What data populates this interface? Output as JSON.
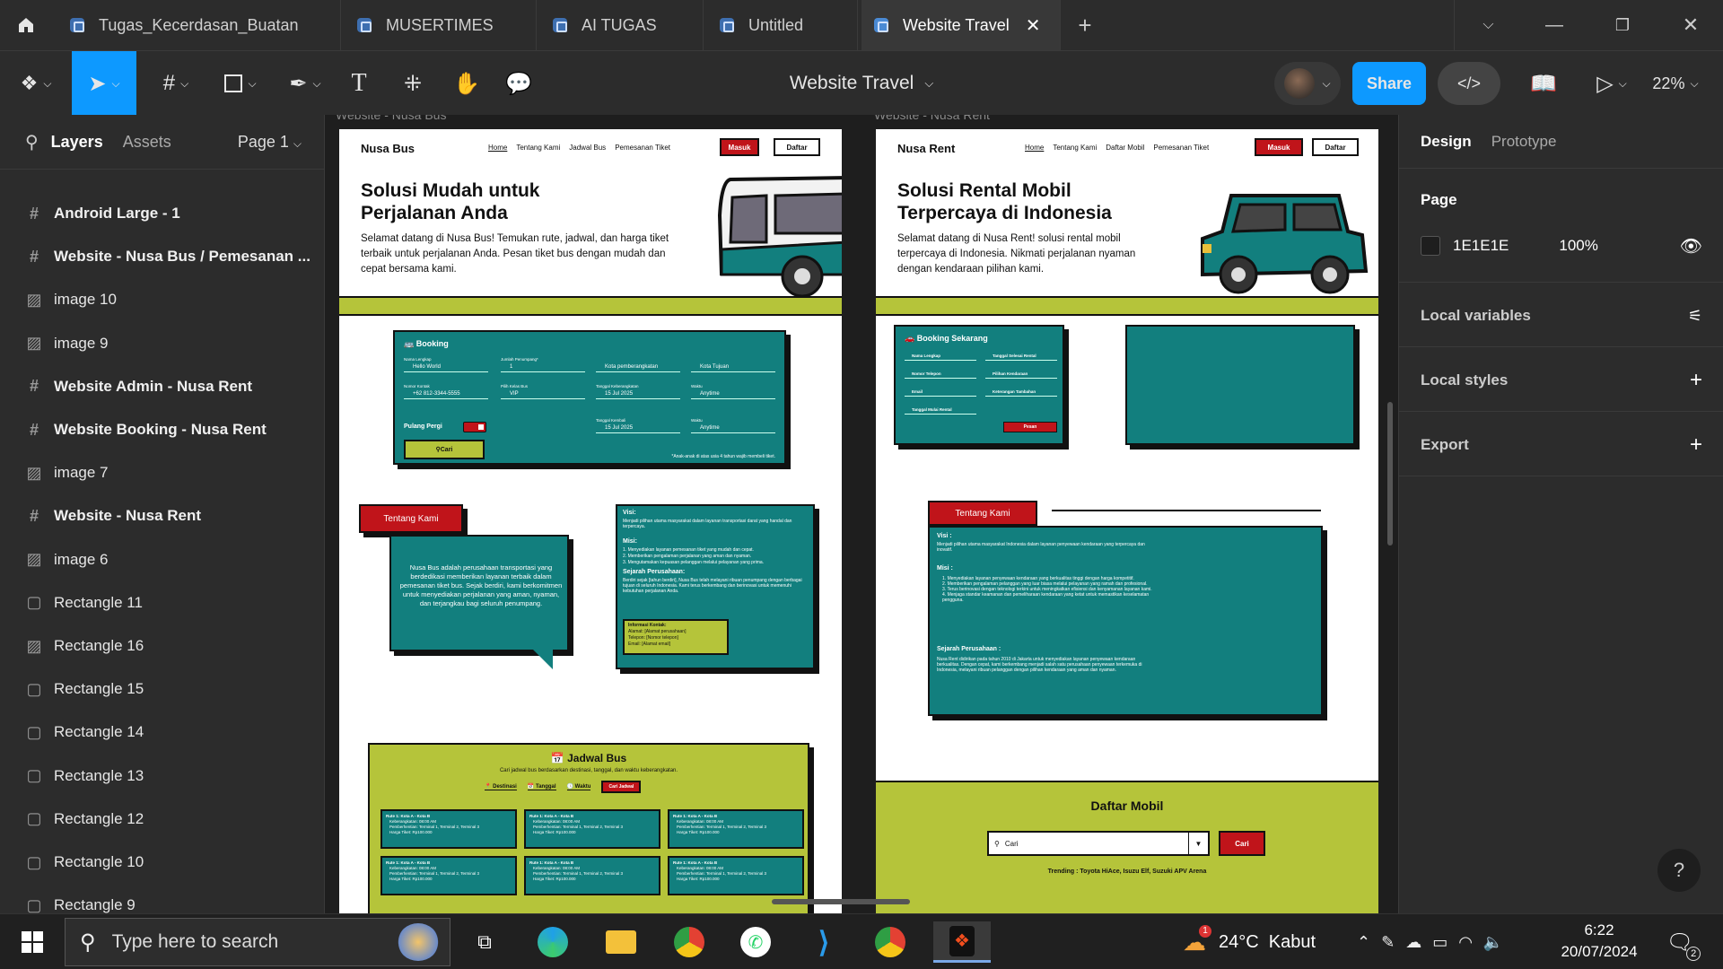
{
  "tabs": [
    {
      "label": "Tugas_Kecerdasan_Buatan"
    },
    {
      "label": "MUSERTIMES"
    },
    {
      "label": "AI TUGAS"
    },
    {
      "label": "Untitled"
    },
    {
      "label": "Website Travel",
      "active": true
    }
  ],
  "toolbar": {
    "file_title": "Website Travel",
    "share_label": "Share",
    "zoom": "22%"
  },
  "left_panel": {
    "tabs": {
      "layers": "Layers",
      "assets": "Assets",
      "page": "Page 1"
    },
    "layers": [
      {
        "label": "Android Large - 1",
        "type": "frame"
      },
      {
        "label": "Website - Nusa Bus / Pemesanan ...",
        "type": "frame"
      },
      {
        "label": "image 10",
        "type": "image"
      },
      {
        "label": "image 9",
        "type": "image"
      },
      {
        "label": "Website Admin - Nusa Rent",
        "type": "frame"
      },
      {
        "label": "Website Booking - Nusa Rent",
        "type": "frame"
      },
      {
        "label": "image 7",
        "type": "image"
      },
      {
        "label": "Website - Nusa Rent",
        "type": "frame"
      },
      {
        "label": "image 6",
        "type": "image"
      },
      {
        "label": "Rectangle 11",
        "type": "rect"
      },
      {
        "label": "Rectangle 16",
        "type": "image"
      },
      {
        "label": "Rectangle 15",
        "type": "rect"
      },
      {
        "label": "Rectangle 14",
        "type": "rect"
      },
      {
        "label": "Rectangle 13",
        "type": "rect"
      },
      {
        "label": "Rectangle 12",
        "type": "rect"
      },
      {
        "label": "Rectangle 10",
        "type": "rect"
      },
      {
        "label": "Rectangle 9",
        "type": "rect"
      }
    ]
  },
  "right_panel": {
    "tabs": {
      "design": "Design",
      "prototype": "Prototype"
    },
    "page_label": "Page",
    "page_color": "1E1E1E",
    "page_opacity": "100%",
    "local_variables": "Local variables",
    "local_styles": "Local styles",
    "export": "Export",
    "help": "?"
  },
  "canvas": {
    "board1_label": "Website - Nusa Bus",
    "board2_label": "Website - Nusa Rent"
  },
  "nusa_bus": {
    "brand": "Nusa Bus",
    "nav": [
      "Home",
      "Tentang Kami",
      "Jadwal Bus",
      "Pemesanan Tiket"
    ],
    "masuk": "Masuk",
    "daftar": "Daftar",
    "hero_title": "Solusi Mudah untuk Perjalanan Anda",
    "hero_text": "Selamat datang di Nusa Bus! Temukan rute, jadwal, dan harga tiket terbaik untuk perjalanan Anda. Pesan tiket bus dengan mudah dan cepat bersama kami.",
    "booking_title": "Booking",
    "booking_fields": [
      {
        "label": "Nama Lengkap",
        "value": "Hello World"
      },
      {
        "label": "Jumlah Penumpang*",
        "value": "1"
      },
      {
        "label": "",
        "value": "Kota pemberangkatan"
      },
      {
        "label": "",
        "value": "Kota Tujuan"
      },
      {
        "label": "Nomor Kontak",
        "value": "+62 812-3344-5555"
      },
      {
        "label": "Pilih Kelas Bus",
        "value": "VIP"
      },
      {
        "label": "Tanggal Keberangkatan",
        "value": "15 Jul 2025"
      },
      {
        "label": "Waktu",
        "value": "Anytime"
      },
      {
        "label": "Tanggal Kembali",
        "value": "15 Jul 2025"
      },
      {
        "label": "Waktu",
        "value": "Anytime"
      }
    ],
    "pulang_pergi": "Pulang Pergi",
    "cari": "Cari",
    "booking_note": "*Anak-anak di atas usia 4 tahun wajib membeli tiket.",
    "tentang_title": "Tentang Kami",
    "tentang_text": "Nusa Bus adalah perusahaan transportasi yang berdedikasi memberikan layanan terbaik dalam pemesanan tiket bus. Sejak berdiri, kami berkomitmen untuk menyediakan perjalanan yang aman, nyaman, dan terjangkau bagi seluruh penumpang.",
    "visi_title": "Visi:",
    "visi_text": "Menjadi pilihan utama masyarakat dalam layanan transportasi darat yang handal dan terpercaya.",
    "misi_title": "Misi:",
    "misi_items": [
      "Menyediakan layanan pemesanan tiket yang mudah dan cepat.",
      "Memberikan pengalaman perjalanan yang aman dan nyaman.",
      "Mengutamakan kepuasan pelanggan melalui pelayanan yang prima."
    ],
    "sejarah_title": "Sejarah Perusahaan:",
    "sejarah_text": "Berdiri sejak [tahun berdiri], Nusa Bus telah melayani ribuan penumpang dengan berbagai tujuan di seluruh Indonesia. Kami terus berkembang dan berinovasi untuk memenuhi kebutuhan perjalanan Anda.",
    "kontak_title": "Informasi Kontak:",
    "kontak_items": [
      "Alamat: [Alamat perusahaan]",
      "Telepon: [Nomor telepon]",
      "Email: [Alamat email]"
    ],
    "jadwal_title": "Jadwal Bus",
    "jadwal_sub": "Cari jadwal bus berdasarkan destinasi, tanggal, dan waktu keberangkatan.",
    "jadwal_filters": [
      "Destinasi",
      "Tanggal",
      "Waktu"
    ],
    "cari_jadwal": "Cari Jadwal",
    "route_title": "Rute 1: Kota A - Kota B",
    "route_lines": [
      "Keberangkatan: 08:00 AM",
      "Pemberhentian: Terminal 1, Terminal 2, Terminal 3",
      "Harga Tiket: Rp100.000"
    ]
  },
  "nusa_rent": {
    "brand": "Nusa Rent",
    "nav": [
      "Home",
      "Tentang Kami",
      "Daftar Mobil",
      "Pemesanan Tiket"
    ],
    "masuk": "Masuk",
    "daftar": "Daftar",
    "hero_title": "Solusi Rental Mobil Terpercaya di Indonesia",
    "hero_text": "Selamat datang di Nusa Rent! solusi rental mobil terpercaya di Indonesia. Nikmati perjalanan nyaman dengan kendaraan pilihan kami.",
    "booking_title": "Booking Sekarang",
    "booking_fields": [
      "Nama Lengkap",
      "Tanggal Selesai Rental",
      "Nomor Telepon",
      "Pilihan Kendaraan",
      "Email",
      "Keterangan Tambahan",
      "Tanggal Mulai Rental"
    ],
    "pesan": "Pesan",
    "tentang_title": "Tentang Kami",
    "visi_title": "Visi :",
    "visi_text": "Menjadi pilihan utama masyarakat Indonesia dalam layanan penyewaan kendaraan yang terpercaya dan inovatif.",
    "misi_title": "Misi :",
    "misi_items": [
      "Menyediakan layanan penyewaan kendaraan yang berkualitas tinggi dengan harga kompetitif.",
      "Memberikan pengalaman pelanggan yang luar biasa melalui pelayanan yang ramah dan profesional.",
      "Terus berinovasi dengan teknologi terkini untuk meningkatkan efisiensi dan kenyamanan layanan kami.",
      "Menjaga standar keamanan dan pemeliharaan kendaraan yang ketat untuk memastikan keselamatan pengguna."
    ],
    "sejarah_title": "Sejarah Perusahaan :",
    "sejarah_text": "Nusa Rent didirikan pada tahun 2010 di Jakarta untuk menyediakan layanan penyewaan kendaraan berkualitas. Dengan cepat, kami berkembang menjadi salah satu perusahaan penyewaan terkemuka di Indonesia, melayani ribuan pelanggan dengan pilihan kendaraan yang aman dan nyaman.",
    "daftar_title": "Daftar Mobil",
    "search_value": "Cari",
    "cari": "Cari",
    "trending": "Trending : Toyota HiAce, Isuzu Elf, Suzuki APV Arena"
  },
  "taskbar": {
    "search_placeholder": "Type here to search",
    "weather": "24°C  Kabut",
    "weather_badge": "1",
    "time": "6:22",
    "date": "20/07/2024",
    "notif_count": "2"
  }
}
